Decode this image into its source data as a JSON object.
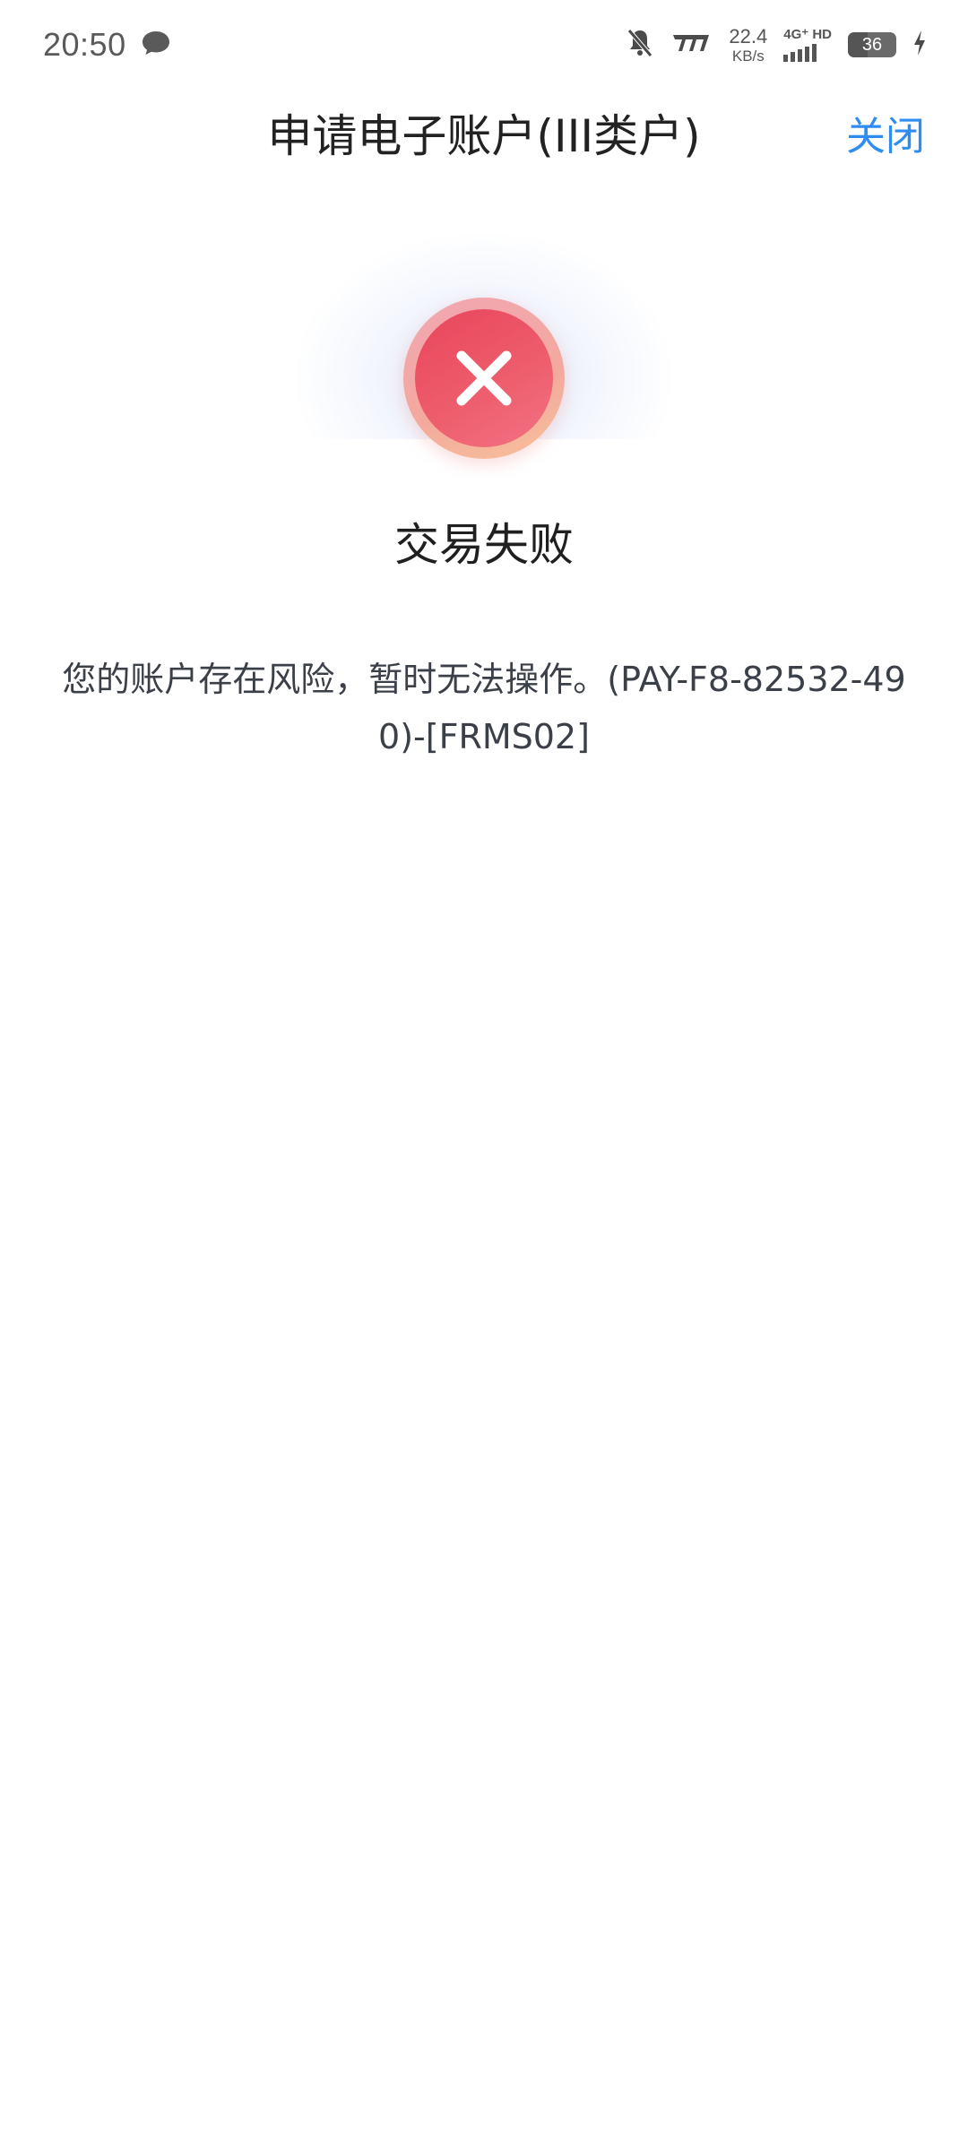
{
  "status_bar": {
    "time": "20:50",
    "net_speed": "22.4",
    "net_unit": "KB/s",
    "network_type": "4G⁺ HD",
    "battery": "36",
    "icons": [
      "chat-bubble-icon",
      "bell-off-icon",
      "vibrate-icon",
      "signal-icon",
      "battery-icon",
      "charging-icon"
    ]
  },
  "header": {
    "title": "申请电子账户(III类户)",
    "close_label": "关闭"
  },
  "result": {
    "icon": "error-x-icon",
    "title": "交易失败",
    "message": "您的账户存在风险，暂时无法操作。(PAY-F8-82532-490)-[FRMS02]"
  },
  "colors": {
    "accent": "#2f8cf0",
    "error": "#e9455b",
    "text": "#222222"
  }
}
